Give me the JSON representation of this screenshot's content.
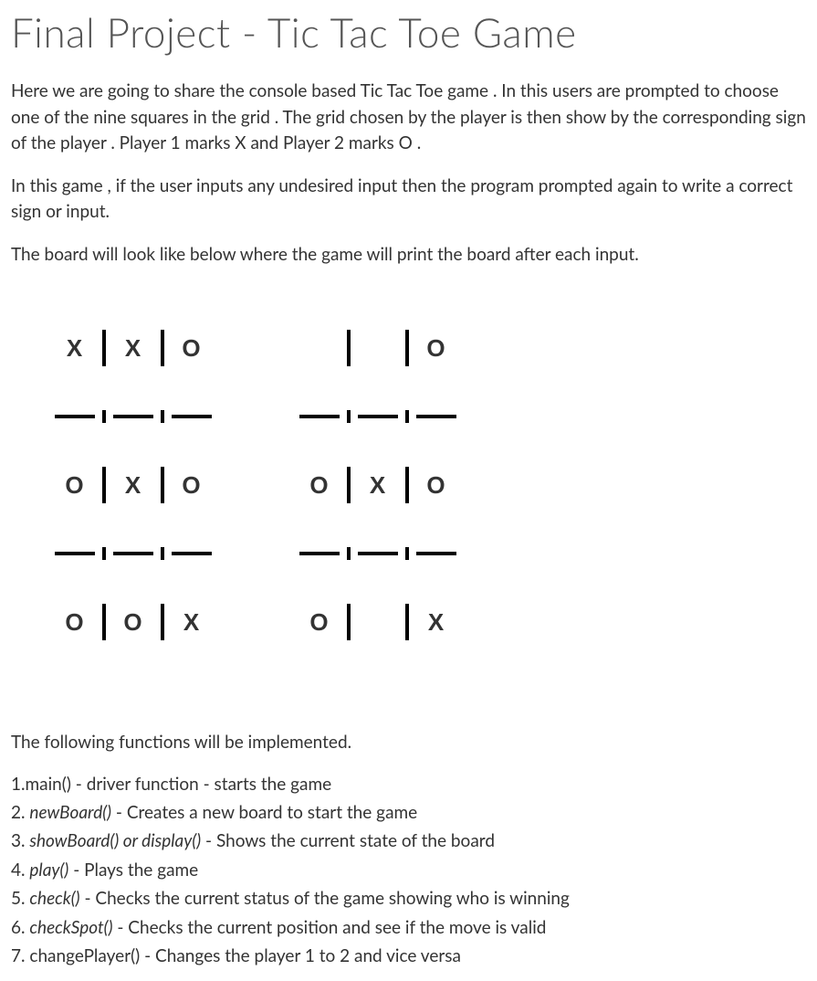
{
  "title": "Final Project - Tic Tac Toe Game",
  "paragraphs": {
    "p1": "Here we are going  to share the  console based Tic Tac Toe game . In this users are prompted to choose one of the nine squares in the grid . The grid chosen by the player is then show by the corresponding sign of the player . Player 1 marks X  and Player 2 marks O  .",
    "p2": "In this game , if the user inputs any undesired input then the program prompted  again to write a correct sign or input.",
    "p3": "The board will look like below where the game will print the board after each input."
  },
  "board1": {
    "r0": {
      "c0": "X",
      "c1": "X",
      "c2": "O"
    },
    "r1": {
      "c0": "O",
      "c1": "X",
      "c2": "O"
    },
    "r2": {
      "c0": "O",
      "c1": "O",
      "c2": "X"
    }
  },
  "board2": {
    "r0": {
      "c0": "",
      "c1": "",
      "c2": "O"
    },
    "r1": {
      "c0": "O",
      "c1": "X",
      "c2": "O"
    },
    "r2": {
      "c0": "O",
      "c1": "",
      "c2": "X"
    }
  },
  "functions_intro": "The following functions will be implemented.",
  "functions": {
    "f1": {
      "num": "1.",
      "name": "main()",
      "desc": " - driver function - starts the game"
    },
    "f2": {
      "num": "2. ",
      "name": "newBoard()",
      "desc": " - Creates a new board to start the game"
    },
    "f3": {
      "num": "3. ",
      "name": "showBoard() or display()",
      "desc": " - Shows the current state of the board"
    },
    "f4": {
      "num": "4. ",
      "name": "play()",
      "desc": " - Plays the game"
    },
    "f5": {
      "num": "5. ",
      "name": "check()",
      "desc": " - Checks the current status of the game showing who is winning"
    },
    "f6": {
      "num": "6. ",
      "name": "checkSpot()",
      "desc": " - Checks the current position and see if the move is valid"
    },
    "f7": {
      "num": "7. ",
      "name": "changePlayer()",
      "desc": " - Changes the player 1 to 2 and vice versa"
    }
  }
}
